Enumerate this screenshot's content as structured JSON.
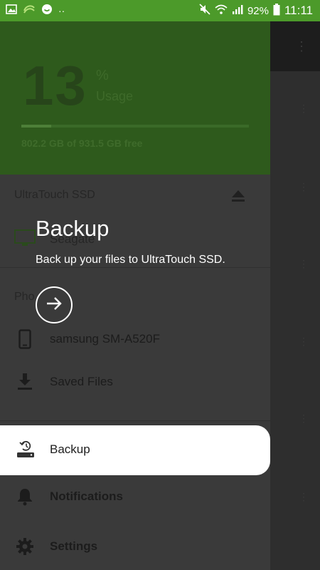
{
  "status_bar": {
    "time": "11:11",
    "battery": "92%",
    "icons": [
      "image-icon",
      "seagate-icon",
      "chat-icon",
      "more-dots-icon",
      "mute-icon",
      "wifi-icon",
      "signal-icon",
      "battery-icon"
    ]
  },
  "drawer": {
    "usage": {
      "percent_value": "13",
      "percent_symbol": "%",
      "label": "Usage",
      "fraction_used": 0.13,
      "free_text": "802.2 GB of 931.5 GB free"
    },
    "drive_section_title": "UltraTouch SSD",
    "drive_brand": "Seagate",
    "phone_section_title": "Pho",
    "items": [
      {
        "label": "samsung SM-A520F",
        "icon": "phone-icon"
      },
      {
        "label": "Saved Files",
        "icon": "download-icon"
      },
      {
        "label": "Backup",
        "icon": "backup-icon"
      },
      {
        "label": "Notifications",
        "icon": "bell-icon"
      },
      {
        "label": "Settings",
        "icon": "gear-icon"
      }
    ]
  },
  "coach": {
    "title": "Backup",
    "description": "Back up your files to UltraTouch SSD.",
    "next_icon": "arrow-right-icon"
  },
  "colors": {
    "status_green": "#4c9a2a",
    "header_dim": "#2e5a1c",
    "overlay_text": "#ffffff"
  }
}
